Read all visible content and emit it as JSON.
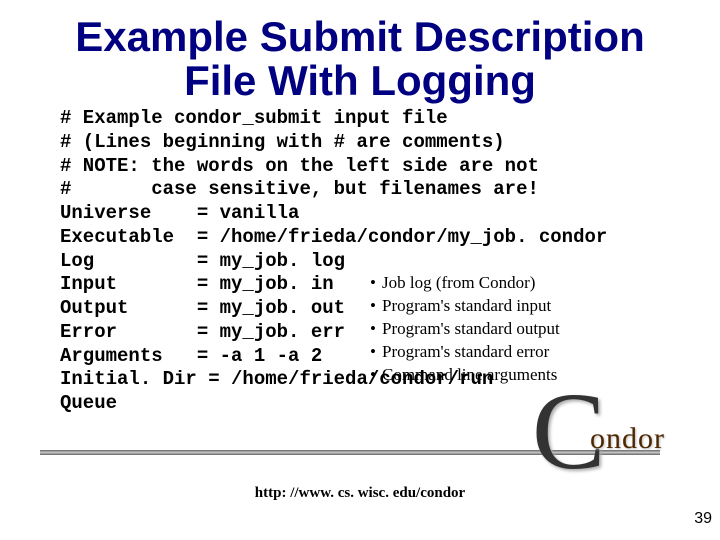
{
  "title_line1": "Example Submit Description",
  "title_line2": "File With Logging",
  "code": "# Example condor_submit input file\n# (Lines beginning with # are comments)\n# NOTE: the words on the left side are not\n#       case sensitive, but filenames are!\nUniverse    = vanilla\nExecutable  = /home/frieda/condor/my_job. condor\nLog         = my_job. log\nInput       = my_job. in\nOutput      = my_job. out\nError       = my_job. err\nArguments   = -a 1 -a 2\nInitial. Dir = /home/frieda/condor/run\nQueue",
  "bullets": [
    "Job log (from Condor)",
    "Program's standard input",
    "Program's standard output",
    "Program's standard error",
    "Command line arguments"
  ],
  "footer_url": "http: //www. cs. wisc. edu/condor",
  "page_number": "39",
  "logo_c": "C",
  "logo_word": "ondor"
}
